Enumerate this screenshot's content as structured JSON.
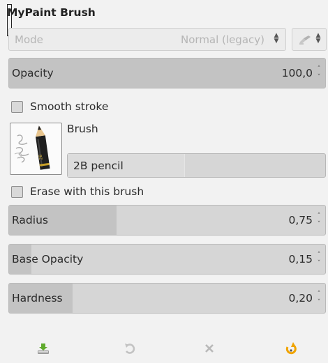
{
  "panel": {
    "title": "MyPaint Brush"
  },
  "mode": {
    "label": "Mode",
    "value": "Normal (legacy)",
    "icon": "brush-mode-icon"
  },
  "opacity": {
    "label": "Opacity",
    "value": "100,0",
    "fill_fraction": 1.0
  },
  "smooth_stroke": {
    "label": "Smooth stroke",
    "checked": false
  },
  "brush": {
    "caption": "Brush",
    "name": "2B pencil",
    "preview_icon": "pencil-brush-icon"
  },
  "erase": {
    "label": "Erase with this brush",
    "checked": false
  },
  "radius": {
    "label": "Radius",
    "value": "0,75",
    "fill_fraction": 0.34
  },
  "base_opacity": {
    "label": "Base Opacity",
    "value": "0,15",
    "fill_fraction": 0.07
  },
  "hardness": {
    "label": "Hardness",
    "value": "0,20",
    "fill_fraction": 0.2
  },
  "bottom_bar": {
    "buttons": [
      {
        "name": "save-options-button",
        "icon": "import-icon",
        "enabled": true
      },
      {
        "name": "restore-options-button",
        "icon": "undo-icon",
        "enabled": false
      },
      {
        "name": "delete-options-button",
        "icon": "close-icon",
        "enabled": false
      },
      {
        "name": "reset-options-button",
        "icon": "reset-icon",
        "enabled": true
      }
    ]
  },
  "colors": {
    "accent_orange": "#f0a400",
    "import_green": "#5faa2c",
    "disabled_gray": "#b9b9b9"
  }
}
